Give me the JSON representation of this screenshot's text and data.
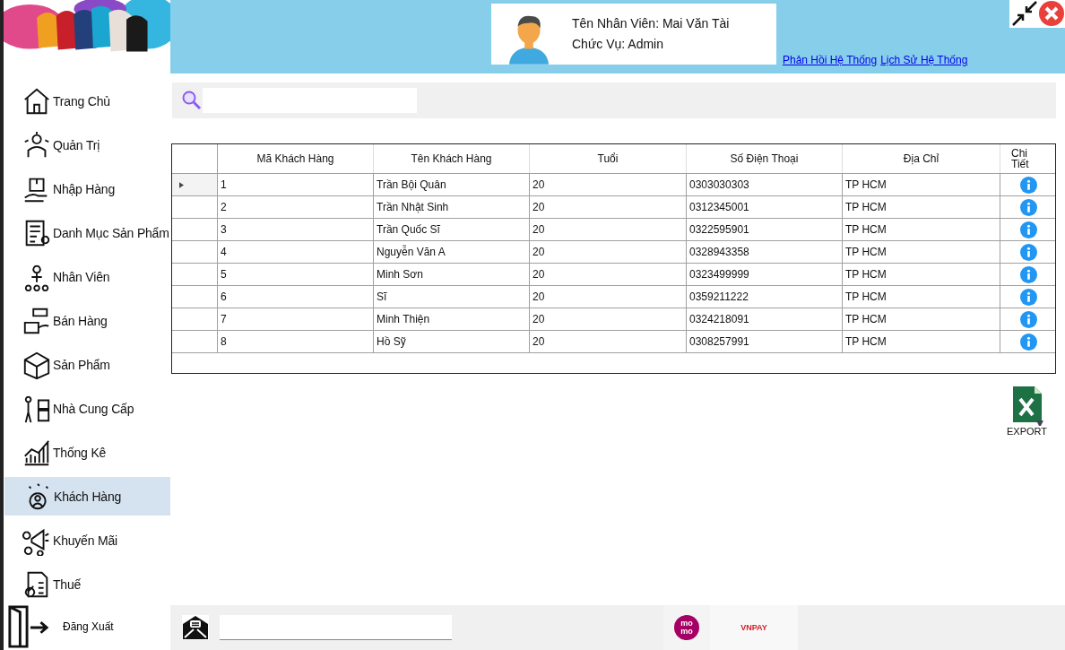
{
  "sidebar": {
    "items": [
      {
        "label": "Trang Chủ",
        "selected": false
      },
      {
        "label": "Quản Trị",
        "selected": false
      },
      {
        "label": "Nhập Hàng",
        "selected": false
      },
      {
        "label": "Danh Mục Sản Phẩm",
        "selected": false
      },
      {
        "label": "Nhân Viên",
        "selected": false
      },
      {
        "label": "Bán Hàng",
        "selected": false
      },
      {
        "label": "Sản Phẩm",
        "selected": false
      },
      {
        "label": "Nhà Cung Cấp",
        "selected": false
      },
      {
        "label": "Thống Kê",
        "selected": false
      },
      {
        "label": "Khách Hàng",
        "selected": true
      },
      {
        "label": "Khuyến Mãi",
        "selected": false
      },
      {
        "label": "Thuế",
        "selected": false
      }
    ],
    "logout": "Đăng Xuất"
  },
  "header": {
    "employee_name": "Tên Nhân Viên: Mai Văn Tài",
    "role": "Chức Vụ: Admin",
    "links": [
      "Phản Hồi Hệ Thống",
      "Lịch Sử Hệ Thống"
    ]
  },
  "table": {
    "columns": [
      "Mã Khách Hàng",
      "Tên Khách Hàng",
      "Tuổi",
      "Số Điện Thoại",
      "Địa Chỉ",
      "Chi Tiết"
    ],
    "rows": [
      {
        "cells": [
          "1",
          "Trần Bội Quân",
          "20",
          "0303030303",
          "TP HCM"
        ],
        "selected": true
      },
      {
        "cells": [
          "2",
          "Trần Nhật Sinh",
          "20",
          "0312345001",
          "TP HCM"
        ],
        "selected": false
      },
      {
        "cells": [
          "3",
          "Trần Quốc Sĩ",
          "20",
          "0322595901",
          "TP HCM"
        ],
        "selected": false
      },
      {
        "cells": [
          "4",
          "Nguyễn Văn A",
          "20",
          "0328943358",
          "TP HCM"
        ],
        "selected": false
      },
      {
        "cells": [
          "5",
          "Minh Sơn",
          "20",
          "0323499999",
          "TP HCM"
        ],
        "selected": false
      },
      {
        "cells": [
          "6",
          "Sĩ",
          "20",
          "0359211222",
          "TP HCM"
        ],
        "selected": false
      },
      {
        "cells": [
          "7",
          "Minh Thiện",
          "20",
          "0324218091",
          "TP HCM"
        ],
        "selected": false
      },
      {
        "cells": [
          "8",
          "Hồ Sỹ",
          "20",
          "0308257991",
          "TP HCM"
        ],
        "selected": false
      }
    ]
  },
  "export_label": "EXPORT",
  "footer": {
    "payments": [
      "mo mo",
      "VNPAY"
    ]
  }
}
